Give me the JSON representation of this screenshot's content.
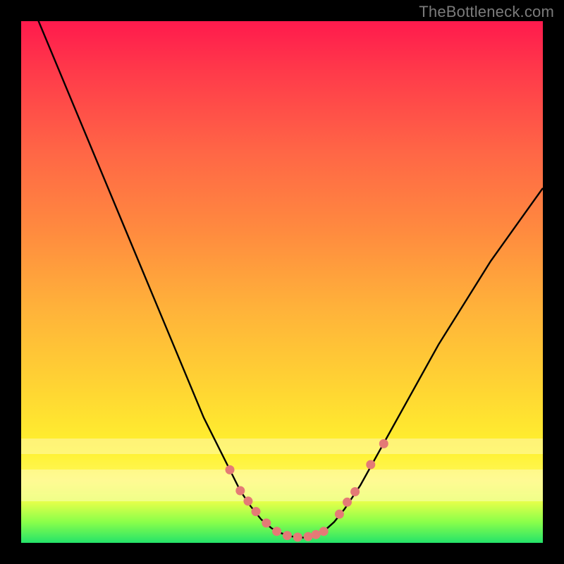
{
  "watermark": "TheBottleneck.com",
  "colors": {
    "frame": "#000000",
    "curve_stroke": "#000000",
    "marker_fill": "#e47a76",
    "marker_stroke": "#c75d59"
  },
  "chart_data": {
    "type": "line",
    "title": "",
    "xlabel": "",
    "ylabel": "",
    "xlim": [
      0,
      100
    ],
    "ylim": [
      0,
      100
    ],
    "grid": false,
    "series": [
      {
        "name": "bottleneck-curve",
        "x": [
          0,
          5,
          10,
          15,
          20,
          25,
          30,
          35,
          40,
          42,
          44,
          46,
          48,
          50,
          52,
          54,
          56,
          58,
          60,
          62,
          65,
          70,
          75,
          80,
          85,
          90,
          95,
          100
        ],
        "y": [
          108,
          96,
          84,
          72,
          60,
          48,
          36,
          24,
          14,
          10,
          7,
          4.5,
          2.8,
          1.8,
          1.2,
          1.0,
          1.3,
          2.2,
          4.0,
          6.5,
          11,
          20,
          29,
          38,
          46,
          54,
          61,
          68
        ]
      }
    ],
    "markers": {
      "name": "highlight-dots",
      "x": [
        40,
        42,
        43.5,
        45,
        47,
        49,
        51,
        53,
        55,
        56.5,
        58,
        61,
        62.5,
        64,
        67,
        69.5
      ],
      "y": [
        14,
        10,
        8,
        6,
        3.8,
        2.2,
        1.4,
        1.1,
        1.2,
        1.6,
        2.2,
        5.5,
        7.8,
        9.8,
        15,
        19
      ]
    },
    "bands": [
      {
        "name": "pale-band-upper",
        "y0": 80,
        "y1": 83
      },
      {
        "name": "pale-band-lower",
        "y0": 86,
        "y1": 92
      }
    ]
  }
}
